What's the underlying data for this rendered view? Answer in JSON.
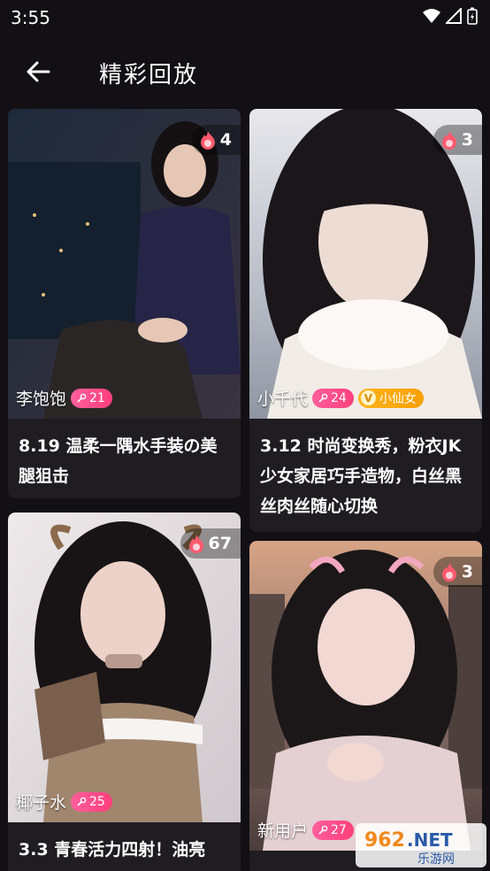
{
  "status_bar": {
    "time": "3:55"
  },
  "header": {
    "title": "精彩回放"
  },
  "cards": [
    {
      "viewers": "4",
      "anchor": "李饱饱",
      "fans": "21",
      "badge": "",
      "description": "8.19 温柔一隅水手装の美腿狙击"
    },
    {
      "viewers": "3",
      "anchor": "小千代",
      "fans": "24",
      "badge": "小仙女",
      "description": "3.12 时尚变换秀，粉衣JK少女家居巧手造物，白丝黑丝肉丝随心切换"
    },
    {
      "viewers": "67",
      "anchor": "椰子水",
      "fans": "25",
      "badge": "",
      "description": "3.3 青春活力四射！油亮"
    },
    {
      "viewers": "3",
      "anchor": "新用户",
      "fans": "27",
      "badge": "",
      "description": ""
    }
  ],
  "watermark": {
    "main": "962.NET",
    "sub": "乐游网"
  },
  "colors": {
    "background": "#121014",
    "card": "#1f1c22",
    "fans_badge": "#ff4f8b",
    "vip_badge": "#f7a000",
    "fire": "#ff5a6e"
  }
}
